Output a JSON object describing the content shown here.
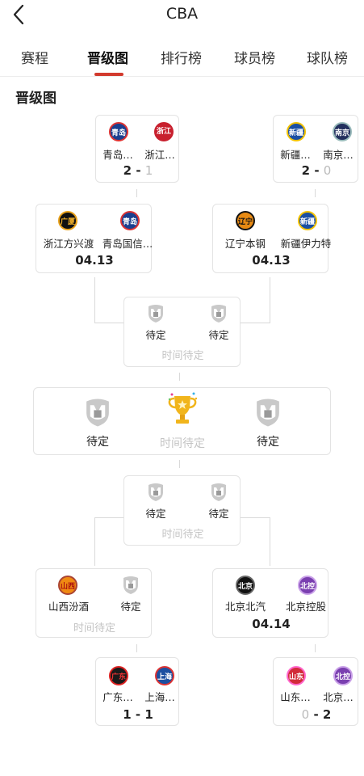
{
  "header": {
    "title": "CBA"
  },
  "tabs": [
    "赛程",
    "晋级图",
    "排行榜",
    "球员榜",
    "球队榜"
  ],
  "section_title": "晋级图",
  "colors": {
    "accent": "#d23a2e",
    "pending": "#c4c4c4"
  },
  "top": {
    "left_r1": {
      "team_a": "青岛…",
      "team_b": "浙江…",
      "badge_a": "青岛",
      "badge_b": "浙江",
      "score_a": "2",
      "score_b": "1"
    },
    "right_r1": {
      "team_a": "新疆…",
      "team_b": "南京…",
      "badge_a": "新疆",
      "badge_b": "南京",
      "score_a": "2",
      "score_b": "0"
    },
    "left_r2": {
      "team_a": "浙江方兴渡",
      "team_b": "青岛国信…",
      "badge_a": "广厦",
      "badge_b": "青岛",
      "date": "04.13"
    },
    "right_r2": {
      "team_a": "辽宁本钢",
      "team_b": "新疆伊力特",
      "badge_a": "辽宁",
      "badge_b": "新疆",
      "date": "04.13"
    },
    "semi": {
      "team_a": "待定",
      "team_b": "待定",
      "time": "时间待定"
    }
  },
  "final": {
    "team_a": "待定",
    "team_b": "待定",
    "time": "时间待定"
  },
  "bottom": {
    "semi": {
      "team_a": "待定",
      "team_b": "待定",
      "time": "时间待定"
    },
    "left_r2": {
      "team_a": "山西汾酒",
      "team_b": "待定",
      "badge_a": "山西",
      "time": "时间待定"
    },
    "right_r2": {
      "team_a": "北京北汽",
      "team_b": "北京控股",
      "badge_a": "北京",
      "badge_b": "北控",
      "date": "04.14"
    },
    "left_r1": {
      "team_a": "广东…",
      "team_b": "上海…",
      "badge_a": "广东",
      "badge_b": "上海",
      "score_a": "1",
      "score_b": "1"
    },
    "right_r1": {
      "team_a": "山东…",
      "team_b": "北京…",
      "badge_a": "山东",
      "badge_b": "北控",
      "score_a": "0",
      "score_b": "2"
    }
  }
}
